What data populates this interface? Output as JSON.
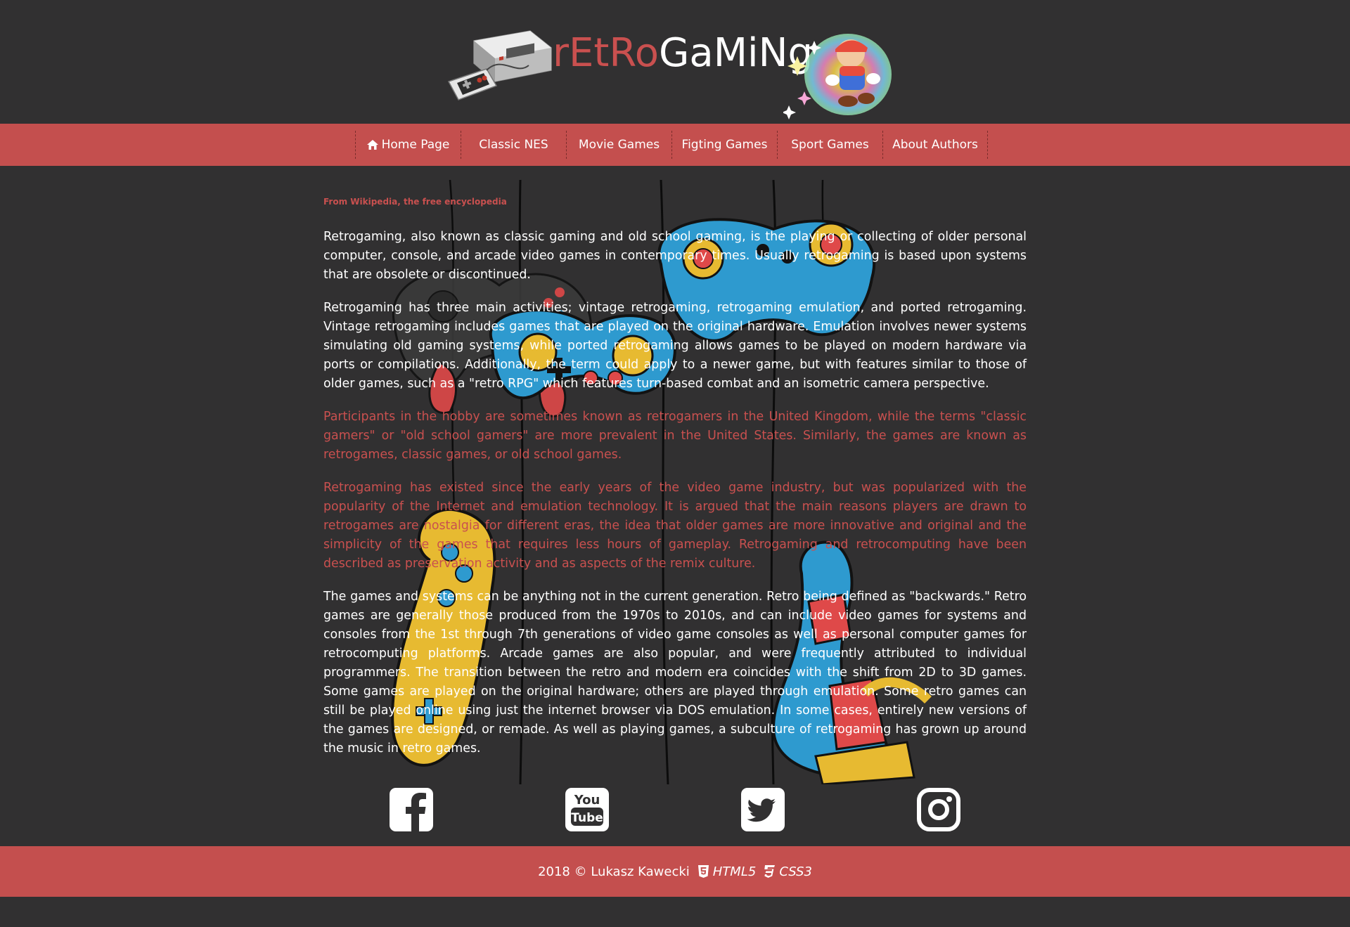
{
  "header": {
    "logo_part1": "rEtRo",
    "logo_part2": "GaMiNg"
  },
  "nav": {
    "items": [
      {
        "label": "Home Page",
        "icon": "home-icon"
      },
      {
        "label": "Classic NES"
      },
      {
        "label": "Movie Games"
      },
      {
        "label": "Figting Games"
      },
      {
        "label": "Sport Games"
      },
      {
        "label": "About Authors"
      }
    ]
  },
  "main": {
    "source": "From Wikipedia, the free encyclopedia",
    "paragraphs": [
      "Retrogaming, also known as classic gaming and old school gaming, is the playing or collecting of older personal computer, console, and arcade video games in contemporary times. Usually retrogaming is based upon systems that are obsolete or discontinued.",
      "Retrogaming has three main activities; vintage retrogaming, retrogaming emulation, and ported retrogaming. Vintage retrogaming includes games that are played on the original hardware. Emulation involves newer systems simulating old gaming systems, while ported retrogaming allows games to be played on modern hardware via ports or compilations. Additionally, the term could apply to a newer game, but with features similar to those of older games, such as a \"retro RPG\" which features turn-based combat and an isometric camera perspective.",
      "Participants in the hobby are sometimes known as retrogamers in the United Kingdom, while the terms \"classic gamers\" or \"old school gamers\" are more prevalent in the United States. Similarly, the games are known as retrogames, classic games, or old school games.",
      "Retrogaming has existed since the early years of the video game industry, but was popularized with the popularity of the Internet and emulation technology. It is argued that the main reasons players are drawn to retrogames are nostalgia for different eras, the idea that older games are more innovative and original and the simplicity of the games that requires less hours of gameplay. Retrogaming and retrocomputing have been described as preservation activity and as aspects of the remix culture.",
      "The games and systems can be anything not in the current generation. Retro being defined as \"backwards.\" Retro games are generally those produced from the 1970s to 2010s, and can include video games for systems and consoles from the 1st through 7th generations of video game consoles as well as personal computer games for retrocomputing platforms. Arcade games are also popular, and were frequently attributed to individual programmers. The transition between the retro and modern era coincides with the shift from 2D to 3D games. Some games are played on the original hardware; others are played through emulation. Some retro games can still be played online using just the internet browser via DOS emulation. In some cases, entirely new versions of the games are designed, or remade. As well as playing games, a subculture of retrogaming has grown up around the music in retro games."
    ]
  },
  "social": {
    "icons": [
      "facebook-icon",
      "youtube-icon",
      "twitter-icon",
      "instagram-icon"
    ],
    "youtube_top": "You",
    "youtube_bottom": "Tube"
  },
  "footer": {
    "copyright": "2018 © Lukasz Kawecki",
    "html": "HTML5",
    "css": "CSS3"
  },
  "colors": {
    "background": "#313031",
    "accent": "#c44f4e",
    "accent_text": "#c9504f",
    "text": "#ffffff"
  }
}
